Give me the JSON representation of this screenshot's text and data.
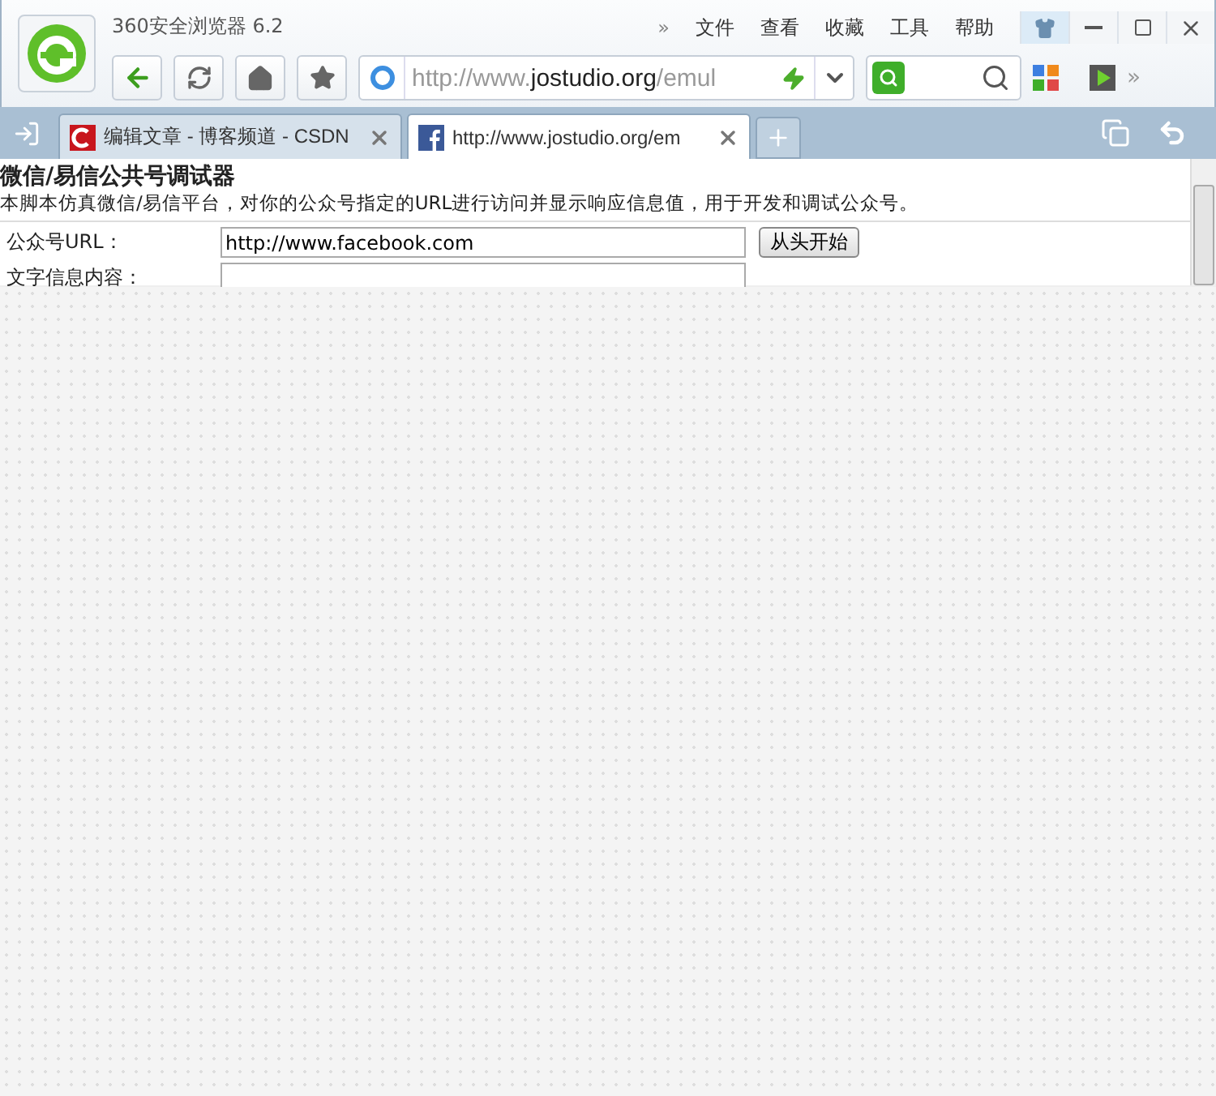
{
  "window": {
    "title": "360安全浏览器 6.2"
  },
  "menu": [
    "文件",
    "查看",
    "收藏",
    "工具",
    "帮助"
  ],
  "menu_more": "»",
  "address": {
    "prefix": "http://www.",
    "domain": "jostudio.org",
    "path": "/emul"
  },
  "toolbar_more": "»",
  "tabs": [
    {
      "label": "编辑文章 - 博客频道 - CSDN",
      "kind": "csdn",
      "selected": false
    },
    {
      "label": "http://www.jostudio.org/em",
      "kind": "facebook",
      "selected": true
    }
  ],
  "page": {
    "heading": "微信/易信公共号调试器",
    "description": "本脚本仿真微信/易信平台，对你的公众号指定的URL进行访问并显示响应信息值，用于开发和调试公众号。",
    "fields": [
      {
        "label": "公众号URL：",
        "value": "http://www.facebook.com",
        "button": "从头开始"
      },
      {
        "label": "文字信息内容："
      }
    ]
  }
}
